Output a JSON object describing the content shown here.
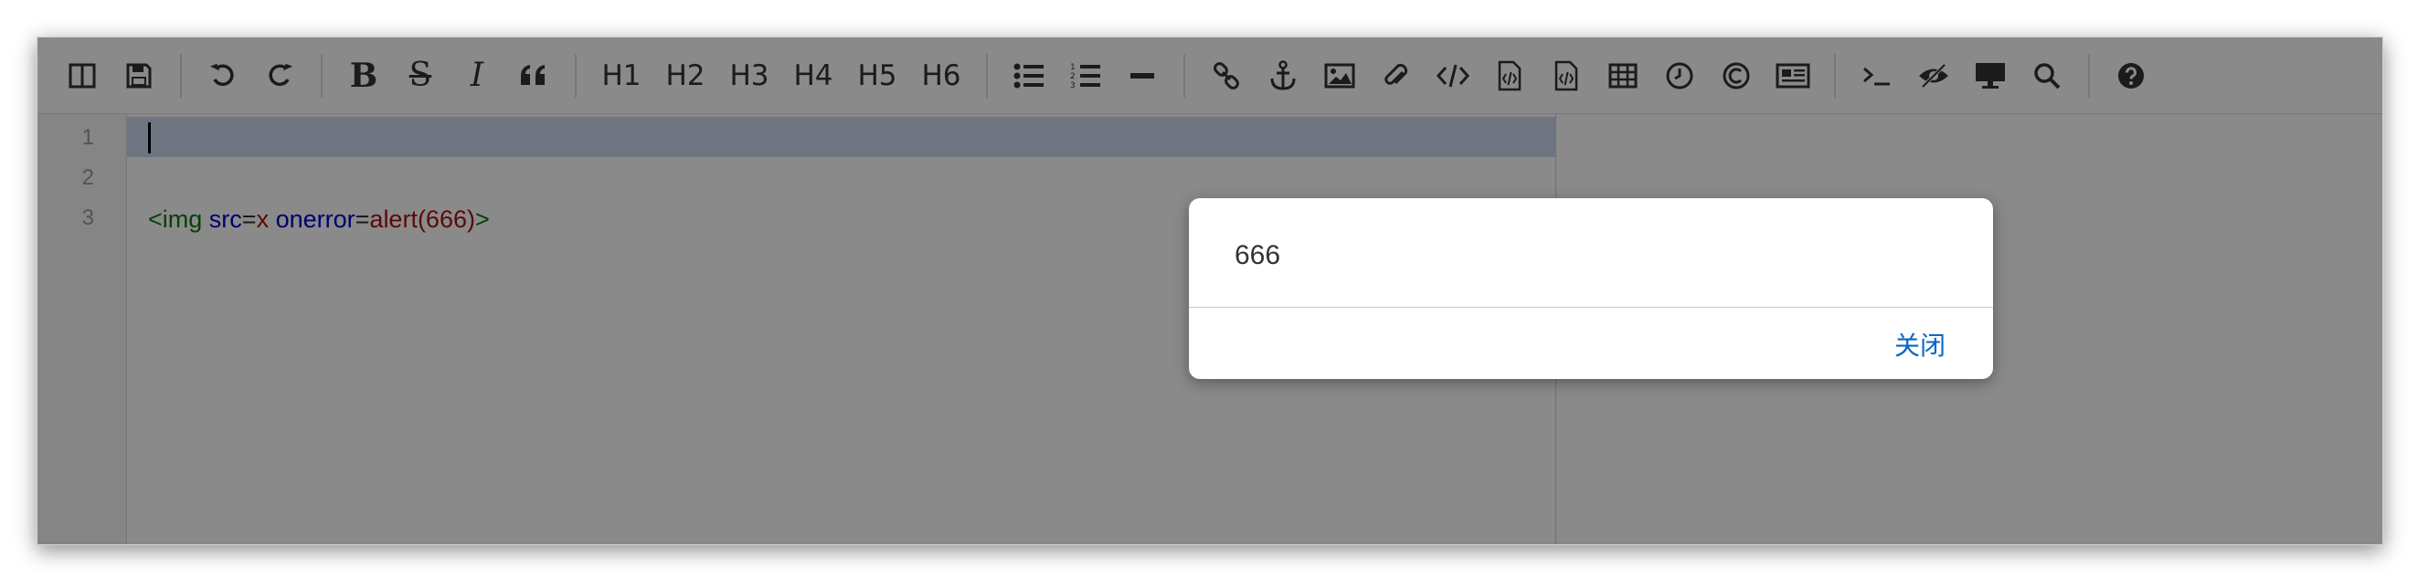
{
  "toolbar": {
    "headings": [
      "H1",
      "H2",
      "H3",
      "H4",
      "H5",
      "H6"
    ]
  },
  "editor": {
    "line_numbers": [
      "1",
      "2",
      "3"
    ],
    "line3": {
      "tag_open": "<img",
      "attr1_name": "src",
      "eq1": "=",
      "attr1_value": "x",
      "attr2_name": "onerror",
      "eq2": "=",
      "attr2_value": "alert(666)",
      "tag_close": ">"
    }
  },
  "dialog": {
    "message": "666",
    "close_label": "关闭"
  },
  "colors": {
    "overlay": "rgba(0,0,0,0.46)",
    "selection": "#ccd9ee",
    "tag": "#117711",
    "attribute": "#0000cc",
    "value": "#aa1111",
    "link": "#0a66c2"
  }
}
